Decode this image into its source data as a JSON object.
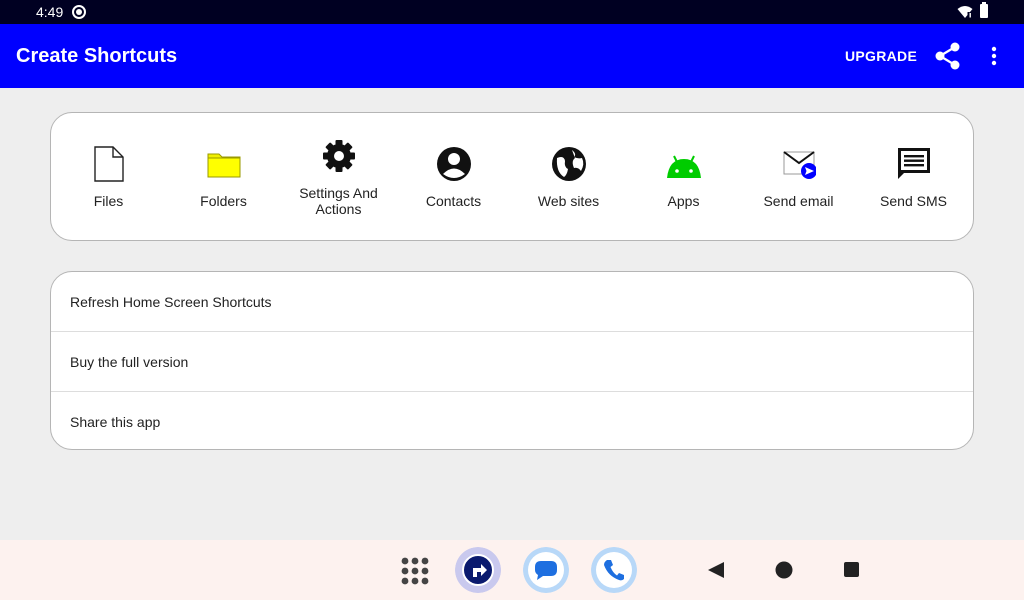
{
  "status_bar": {
    "time": "4:49"
  },
  "app_bar": {
    "title": "Create Shortcuts",
    "upgrade_label": "UPGRADE"
  },
  "shortcuts": [
    {
      "label": "Files",
      "icon": "file-icon"
    },
    {
      "label": "Folders",
      "icon": "folder-icon"
    },
    {
      "label": "Settings And Actions",
      "icon": "gear-icon"
    },
    {
      "label": "Contacts",
      "icon": "account-icon"
    },
    {
      "label": "Web sites",
      "icon": "globe-icon"
    },
    {
      "label": "Apps",
      "icon": "android-icon"
    },
    {
      "label": "Send email",
      "icon": "email-send-icon"
    },
    {
      "label": "Send SMS",
      "icon": "message-icon"
    }
  ],
  "menu": [
    {
      "label": "Refresh Home Screen Shortcuts"
    },
    {
      "label": "Buy the full version"
    },
    {
      "label": "Share this app"
    }
  ],
  "navigation": {
    "dock": [
      "apps-grid-icon",
      "shortcut-app-icon",
      "messages-app-icon",
      "phone-app-icon"
    ],
    "system": [
      "back-icon",
      "home-icon",
      "recents-icon"
    ]
  },
  "colors": {
    "app_bar": "#0000ff",
    "status_bar": "#000022",
    "folder": "#ffff00",
    "android": "#00cc00",
    "background": "#eeeeee",
    "nav_bar": "#fdf2ef"
  }
}
